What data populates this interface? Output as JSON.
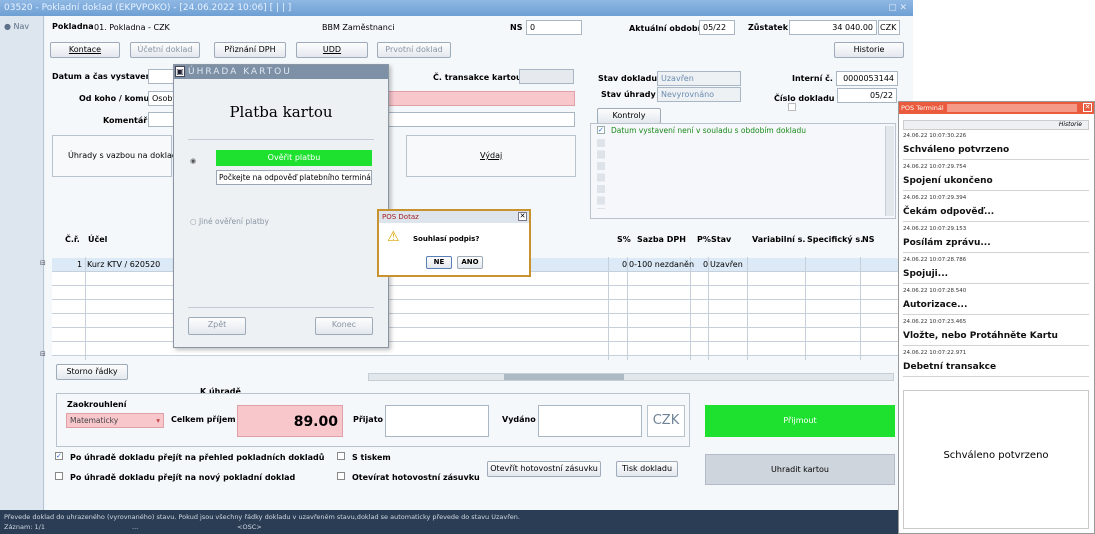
{
  "window": {
    "title": "03520 - Pokladní doklad (EKPVPOKO) - [24.06.2022 10:06] [ | | ]",
    "controls": "▢ ✕"
  },
  "nav": {
    "label": "Nav"
  },
  "header": {
    "pokladna_label": "Pokladna",
    "pokladna_value": "01. Pokladna - CZK",
    "bbm": "BBM Zaměstnanci",
    "ns_label": "NS",
    "ns_value": "0",
    "obdobi_label": "Aktuální období",
    "obdobi_value": "05/22",
    "zustatek_label": "Zůstatek",
    "zustatek_value": "34 040.00",
    "currency": "CZK",
    "historie": "Historie"
  },
  "toolbar": {
    "kontace": "Kontace",
    "ucetni": "Účetní doklad",
    "dph": "Přiznání DPH",
    "udd": "UDD",
    "prvotni": "Prvotní doklad"
  },
  "form": {
    "datum_label": "Datum a čas vystavení",
    "odkoho_label": "Od koho / komu",
    "odkoho_value": "Osoby",
    "komentar_label": "Komentář",
    "transakce_label": "Č. transakce kartou",
    "stav_label": "Stav dokladu",
    "stav_value": "Uzavřen",
    "uhrady_label": "Stav úhrady",
    "uhrady_value": "Nevyrovnáno",
    "interni_label": "Interní č.",
    "interni_value": "0000053144",
    "cislo_label": "Číslo dokladu",
    "cislo_value": "05/22",
    "kontroly": "Kontroly",
    "warning": "Datum vystavení není v souladu s obdobím dokladu",
    "uhrady_vazba": "Úhrady s vazbou na doklad",
    "vydaj": "Výdaj"
  },
  "grid": {
    "headers": [
      "Č.ř.",
      "Účel",
      "S%",
      "Sazba DPH",
      "P%",
      "Stav",
      "Variabilní s.",
      "Specifický s.",
      "NS"
    ],
    "row": {
      "cislo": "1",
      "ucel": "Kurz KTV / 620520",
      "s": "0",
      "sazba": "0-100 nezdaněn",
      "p": "0",
      "stav": "Uzavřen"
    }
  },
  "bottom": {
    "storno": "Storno řádky",
    "k_uhrade": "K úhradě",
    "zaokrouhleni": "Zaokrouhlení",
    "zaokrouhleni_value": "Matematicky",
    "celkem_label": "Celkem příjem",
    "celkem_value": "89.00",
    "prijato": "Přijato",
    "vydano": "Vydáno",
    "czk": "CZK",
    "prijmout": "Přijmout",
    "chk1": "Po úhradě dokladu přejít na přehled pokladních dokladů",
    "chk2": "Po úhradě dokladu přejít na nový pokladní doklad",
    "chk3": "S tiskem",
    "chk4": "Otevírat hotovostní zásuvku",
    "otevrit": "Otevřít hotovostní zásuvku",
    "tisk": "Tisk dokladu",
    "uhradit": "Uhradit kartou"
  },
  "status": {
    "line1": "Převede doklad do uhrazeného (vyrovnaného) stavu. Pokud jsou všechny řádky dokladu v uzavřeném stavu,doklad se automaticky převede do stavu Uzavřen.",
    "zaznam": "Záznam: 1/1",
    "dots": "...",
    "osc": "<OSC>"
  },
  "card_dialog": {
    "title": "ÚHRADA KARTOU",
    "heading": "Platba kartou",
    "verify": "Ověřit platbu",
    "wait": "Počkejte na odpověď platebního terminálu.",
    "other": "Jiné ověření platby",
    "back": "Zpět",
    "end": "Konec"
  },
  "pos_query": {
    "title": "POS Dotaz",
    "question": "Souhlasí podpis?",
    "no": "NE",
    "yes": "ANO"
  },
  "pos_terminal": {
    "title": "POS Terminál",
    "historie": "Historie",
    "entries": [
      {
        "ts": "24.06.22 10:07:30.226",
        "text": "Schváleno potvrzeno"
      },
      {
        "ts": "24.06.22 10:07:29.754",
        "text": "Spojení ukončeno"
      },
      {
        "ts": "24.06.22 10:07:29.394",
        "text": "Čekám odpověď..."
      },
      {
        "ts": "24.06.22 10:07:29.153",
        "text": "Posílám zprávu..."
      },
      {
        "ts": "24.06.22 10:07:28.786",
        "text": "Spojuji..."
      },
      {
        "ts": "24.06.22 10:07:28.540",
        "text": "Autorizace..."
      },
      {
        "ts": "24.06.22 10:07:23.465",
        "text": "Vložte, nebo Protáhněte Kartu"
      },
      {
        "ts": "24.06.22 10:07:22.971",
        "text": "Debetní transakce"
      }
    ],
    "final": "Schváleno potvrzeno"
  },
  "colors": {
    "accent_green": "#1ee12f",
    "terminal_red": "#ea5a3c",
    "pink": "#f8c7cc",
    "dialog_border": "#c8922e"
  }
}
